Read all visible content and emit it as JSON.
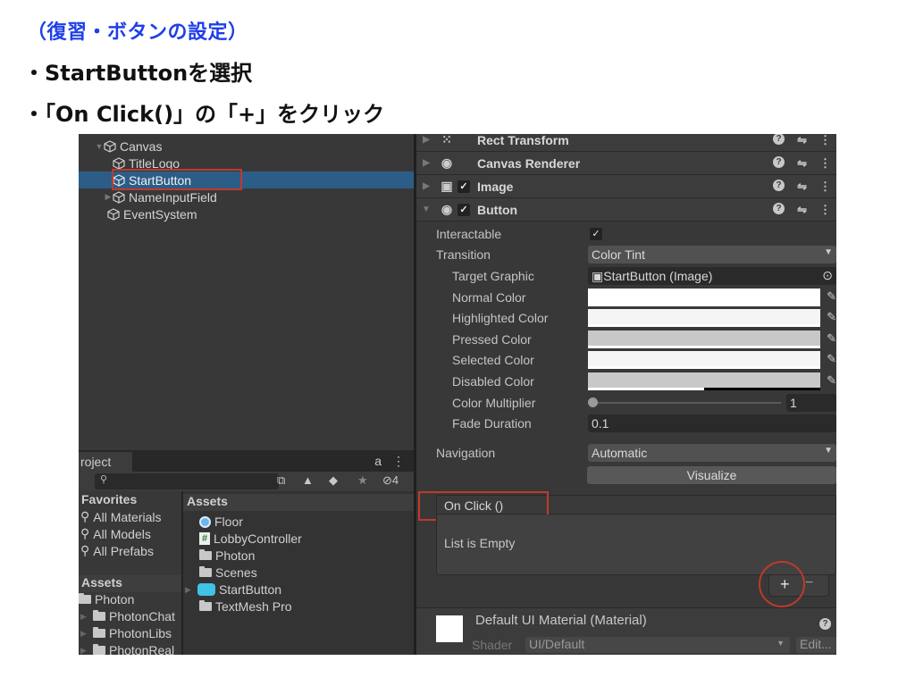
{
  "slide": {
    "title": "（復習・ボタンの設定）",
    "bullets": [
      "・StartButtonを選択",
      "・「On Click()」の「+」をクリック"
    ]
  },
  "hierarchy": {
    "items": [
      {
        "label": "Canvas",
        "expanded": true
      },
      {
        "label": "TitleLogo"
      },
      {
        "label": "StartButton",
        "selected": true,
        "highlighted": true
      },
      {
        "label": "NameInputField",
        "collapsed": true
      },
      {
        "label": "EventSystem"
      }
    ]
  },
  "project": {
    "tab_label": "roject",
    "search_placeholder": "",
    "hidden_count": "4",
    "favorites_header": "Favorites",
    "favorites": [
      "All Materials",
      "All Models",
      "All Prefabs"
    ],
    "assets_header": "Assets",
    "tree": [
      "Photon",
      "PhotonChat",
      "PhotonLibs",
      "PhotonReal"
    ],
    "assets_column_header": "Assets",
    "assets": [
      {
        "label": "Floor",
        "icon": "material-icon"
      },
      {
        "label": "LobbyController",
        "icon": "script-icon"
      },
      {
        "label": "Photon",
        "icon": "folder-icon"
      },
      {
        "label": "Scenes",
        "icon": "folder-icon"
      },
      {
        "label": "StartButton",
        "icon": "prefab-icon"
      },
      {
        "label": "TextMesh Pro",
        "icon": "folder-icon"
      }
    ]
  },
  "inspector": {
    "components": [
      {
        "label": "Rect Transform",
        "checkbox": false
      },
      {
        "label": "Canvas Renderer",
        "checkbox": false
      },
      {
        "label": "Image",
        "checkbox": true
      },
      {
        "label": "Button",
        "checkbox": true,
        "expanded": true
      }
    ],
    "button": {
      "interactable_label": "Interactable",
      "interactable_value": true,
      "transition_label": "Transition",
      "transition_value": "Color Tint",
      "target_graphic_label": "Target Graphic",
      "target_graphic_value": "StartButton (Image)",
      "colors": [
        {
          "label": "Normal Color",
          "color": "#ffffff"
        },
        {
          "label": "Highlighted Color",
          "color": "#f5f5f5"
        },
        {
          "label": "Pressed Color",
          "color": "#c8c8c8"
        },
        {
          "label": "Selected Color",
          "color": "#f5f5f5"
        },
        {
          "label": "Disabled Color",
          "color": "#c8c8c8",
          "alpha_fraction": 0.5
        }
      ],
      "color_multiplier_label": "Color Multiplier",
      "color_multiplier_value": "1",
      "fade_duration_label": "Fade Duration",
      "fade_duration_value": "0.1",
      "navigation_label": "Navigation",
      "navigation_value": "Automatic",
      "visualize_label": "Visualize",
      "onclick_label": "On Click ()",
      "list_empty_label": "List is Empty",
      "plus_label": "+",
      "minus_label": "−"
    },
    "material": {
      "title": "Default UI Material (Material)",
      "shader_label": "Shader",
      "shader_value": "UI/Default",
      "edit_label": "Edit..."
    }
  },
  "colors": {
    "title_blue": "#1f3fe8",
    "highlight_red": "#c0392b",
    "selection_blue": "#2c5d87"
  }
}
